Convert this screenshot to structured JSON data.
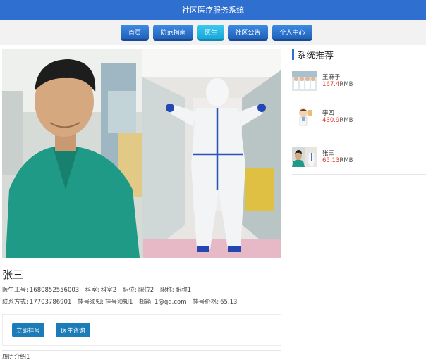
{
  "site": {
    "title": "社区医疗服务系统"
  },
  "nav": [
    {
      "label": "首页",
      "active": false
    },
    {
      "label": "防范指南",
      "active": false
    },
    {
      "label": "医生",
      "active": true
    },
    {
      "label": "社区公告",
      "active": false
    },
    {
      "label": "个人中心",
      "active": false
    }
  ],
  "doctor": {
    "name": "张三",
    "row1": [
      {
        "label": "医生工号:",
        "value": "1680852556003"
      },
      {
        "label": "科室:",
        "value": "科室2"
      },
      {
        "label": "职位:",
        "value": "职位2"
      },
      {
        "label": "职称:",
        "value": "职称1"
      }
    ],
    "row2": [
      {
        "label": "联系方式:",
        "value": "17703786901"
      },
      {
        "label": "挂号须知:",
        "value": "挂号须知1"
      },
      {
        "label": "邮箱:",
        "value": "1@qq.com"
      },
      {
        "label": "挂号价格:",
        "value": "65.13"
      }
    ],
    "register_button": "立即挂号",
    "consult_button": "医生咨询",
    "resume": "履历介绍1"
  },
  "recommend": {
    "title": "系统推荐",
    "currency": "RMB",
    "items": [
      {
        "name": "王麻子",
        "price": "167.4",
        "thumb": "team-photo"
      },
      {
        "name": "李四",
        "price": "430.9",
        "thumb": "cartoon-doctor"
      },
      {
        "name": "张三",
        "price": "65.13",
        "thumb": "doctor-photo"
      }
    ]
  }
}
